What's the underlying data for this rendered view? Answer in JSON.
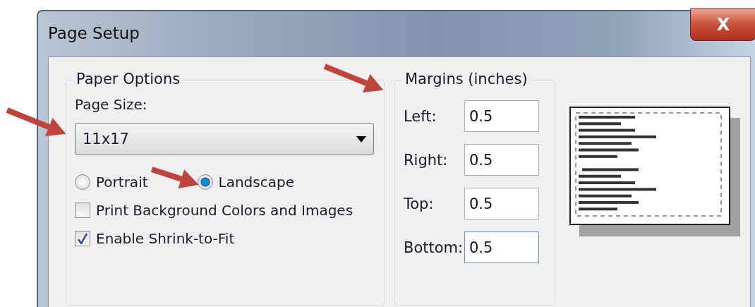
{
  "window": {
    "title": "Page Setup",
    "close_label": "X"
  },
  "paper_options": {
    "legend": "Paper Options",
    "page_size_label": "Page Size:",
    "page_size": "11x17",
    "orientations": [
      {
        "label": "Portrait",
        "selected": false
      },
      {
        "label": "Landscape",
        "selected": true
      }
    ],
    "checkboxes": [
      {
        "label": "Print Background Colors and Images",
        "checked": false
      },
      {
        "label": "Enable Shrink-to-Fit",
        "checked": true
      }
    ]
  },
  "margins": {
    "legend": "Margins (inches)",
    "fields": [
      {
        "label": "Left:",
        "value": "0.5",
        "focused": false
      },
      {
        "label": "Right:",
        "value": "0.5",
        "focused": false
      },
      {
        "label": "Top:",
        "value": "0.5",
        "focused": false
      },
      {
        "label": "Bottom:",
        "value": "0.5",
        "focused": true
      }
    ]
  }
}
